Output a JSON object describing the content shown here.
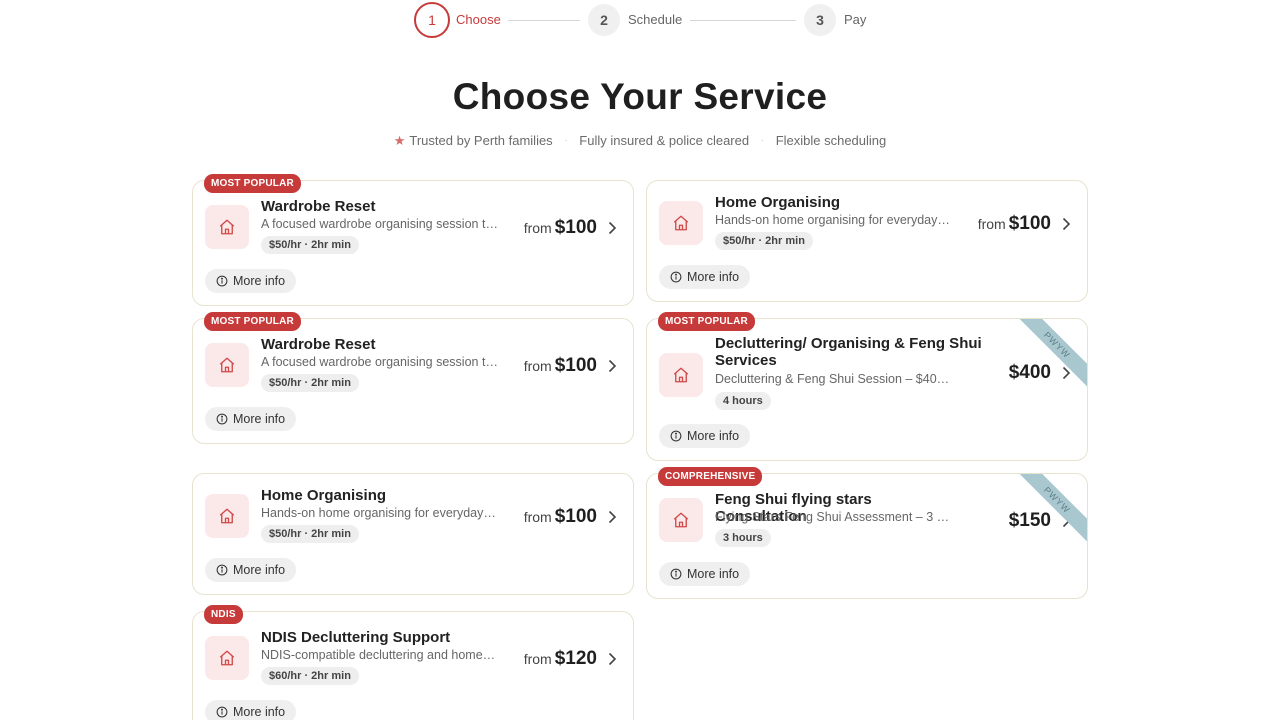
{
  "stepper": {
    "steps": [
      {
        "number": "1",
        "label": "Choose"
      },
      {
        "number": "2",
        "label": "Schedule"
      },
      {
        "number": "3",
        "label": "Pay"
      }
    ]
  },
  "header": {
    "title": "Choose Your Service",
    "trust": [
      "Trusted by Perth families",
      "Fully insured & police cleared",
      "Flexible scheduling"
    ]
  },
  "more_info_label": "More info",
  "from_label": "from",
  "cards": [
    {
      "badge": "MOST POPULAR",
      "name": "Wardrobe Reset",
      "desc": "A focused wardrobe organising session to…",
      "pill": "$50/hr · 2hr min",
      "price": "$100",
      "has_from": true
    },
    {
      "badge": "",
      "name": "Home Organising",
      "desc": "Hands-on home organising for everyday…",
      "pill": "$50/hr · 2hr min",
      "price": "$100",
      "has_from": true
    },
    {
      "badge": "MOST POPULAR",
      "name": "Wardrobe Reset",
      "desc": "A focused wardrobe organising session to…",
      "pill": "$50/hr · 2hr min",
      "price": "$100",
      "has_from": true
    },
    {
      "badge": "MOST POPULAR",
      "name": "Decluttering/ Organising & Feng Shui Services",
      "desc": "Decluttering & Feng Shui Session – $400 (4…",
      "pill": "4 hours",
      "price": "$400",
      "has_from": false,
      "ribbon": "PWYW"
    },
    {
      "badge": "",
      "name": "Home Organising",
      "desc": "Hands-on home organising for everyday…",
      "pill": "$50/hr · 2hr min",
      "price": "$100",
      "has_from": true
    },
    {
      "badge": "COMPREHENSIVE",
      "name": "Feng Shui flying stars Consultation",
      "desc": "Flying Stars Feng Shui Assessment – 3 Stages. A…",
      "pill": "3 hours",
      "price": "$150",
      "has_from": false,
      "ribbon": "PWYW"
    },
    {
      "badge": "NDIS",
      "name": "NDIS Decluttering Support",
      "desc": "NDIS-compatible decluttering and home…",
      "pill": "$60/hr · 2hr min",
      "price": "$120",
      "has_from": true
    }
  ],
  "colors": {
    "accent": "#c73a3a",
    "icon_bg": "#fbe9e9",
    "card_border": "#e7e3cf",
    "ribbon": "#a8c7cf"
  }
}
